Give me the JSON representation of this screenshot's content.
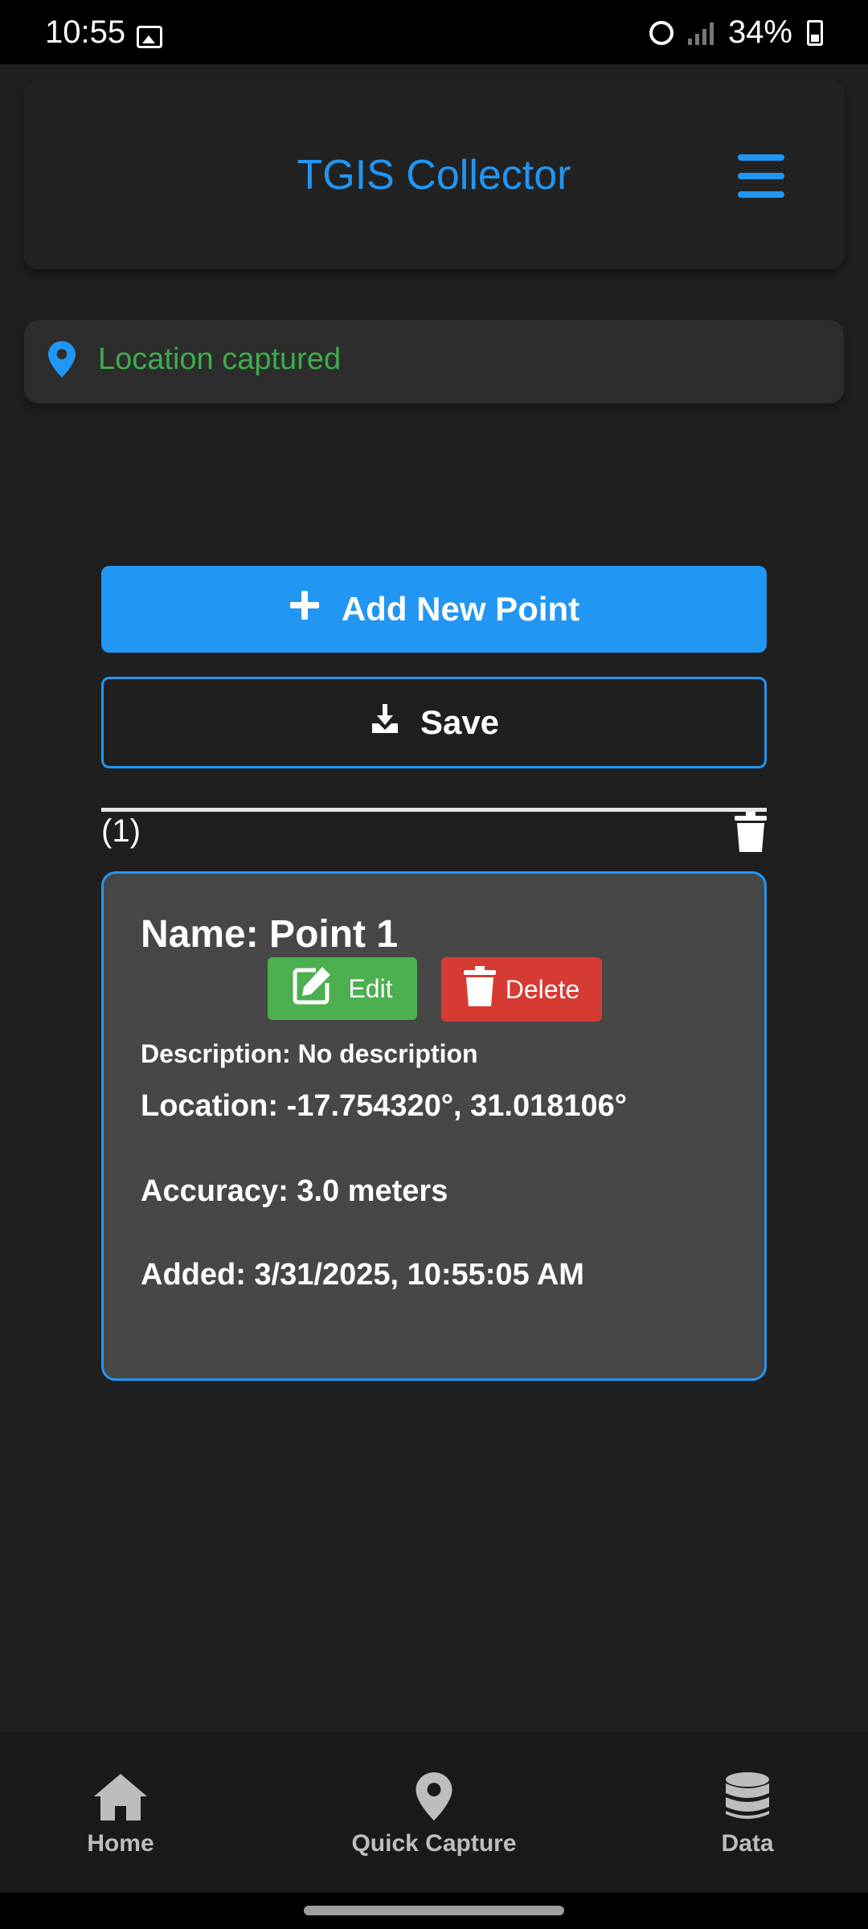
{
  "status_bar": {
    "time": "10:55",
    "battery": "34%"
  },
  "header": {
    "title": "TGIS Collector"
  },
  "location_banner": {
    "text": "Location captured"
  },
  "actions": {
    "add_point": "Add New Point",
    "save": "Save"
  },
  "list": {
    "count": "(1)"
  },
  "point_card": {
    "name": "Name: Point 1",
    "edit": "Edit",
    "delete": "Delete",
    "description": "Description: No description",
    "location": "Location: -17.754320°, 31.018106°",
    "accuracy": "Accuracy: 3.0 meters",
    "added": "Added: 3/31/2025, 10:55:05 AM"
  },
  "bottom_nav": {
    "home": "Home",
    "quick_capture": "Quick Capture",
    "data": "Data"
  },
  "colors": {
    "primary": "#2196f3",
    "success": "#4caf50",
    "danger": "#d63b33",
    "location_text": "#3cad4a"
  }
}
